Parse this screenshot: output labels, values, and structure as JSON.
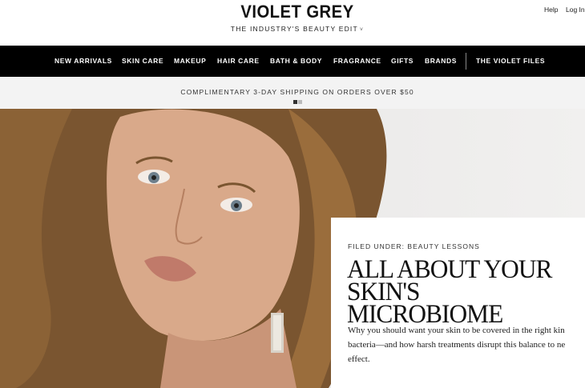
{
  "header": {
    "logo": "VIOLET GREY",
    "tagline": "THE INDUSTRY'S BEAUTY EDIT",
    "tagline_chevron": "˅",
    "help": "Help",
    "login": "Log In"
  },
  "nav": {
    "items": [
      "NEW ARRIVALS",
      "SKIN CARE",
      "MAKEUP",
      "HAIR CARE",
      "BATH & BODY",
      "FRAGRANCE",
      "GIFTS",
      "BRANDS"
    ],
    "violet_files": "THE VIOLET FILES"
  },
  "promo": {
    "text": "COMPLIMENTARY 3-DAY SHIPPING ON ORDERS OVER $50",
    "slides": 2,
    "active_slide": 1
  },
  "feature": {
    "filed_under": "FILED UNDER: BEAUTY LESSONS",
    "headline_line1": "ALL ABOUT YOUR",
    "headline_line2": "SKIN'S MICROBIOME",
    "dek_line1": "Why you should want your skin to be covered in  the right kin",
    "dek_line2": "bacteria—and how harsh treatments disrupt this balance to ne",
    "dek_line3": "effect."
  },
  "colors": {
    "nav_bg": "#000000",
    "promo_bg": "#f3f3f3",
    "text": "#111111"
  }
}
